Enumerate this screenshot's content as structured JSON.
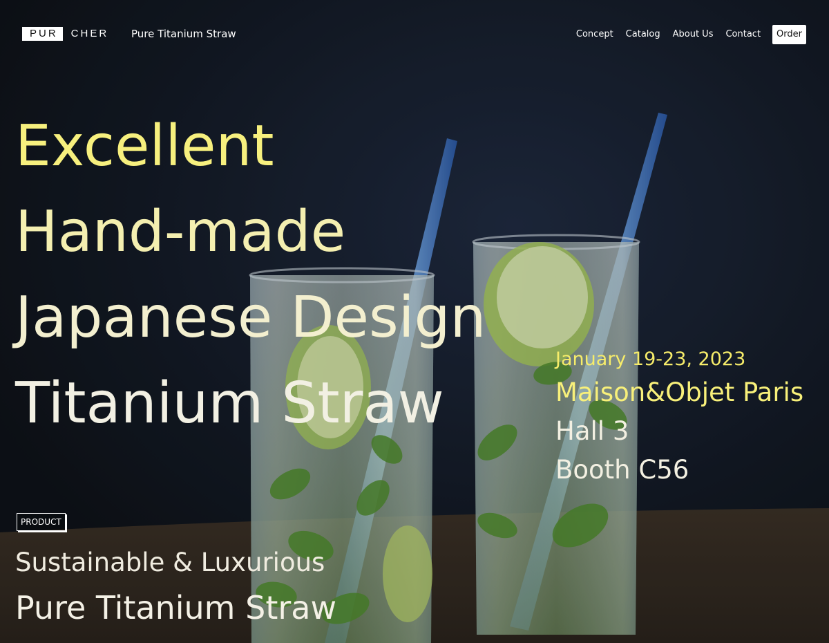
{
  "header": {
    "logo": {
      "boxed": "PUR",
      "rest": "CHER"
    },
    "tagline": "Pure Titanium Straw",
    "nav": [
      "Concept",
      "Catalog",
      "About Us",
      "Contact"
    ],
    "order_label": "Order"
  },
  "hero": {
    "headline": [
      "Excellent",
      "Hand-made",
      "Japanese Design",
      "Titanium Straw"
    ],
    "image": "two glasses of mojito with lime, mint and blue titanium straws"
  },
  "event": {
    "date": "January 19-23, 2023",
    "venue": "Maison&Objet Paris",
    "hall": "Hall 3",
    "booth": "Booth C56"
  },
  "product": {
    "badge": "PRODUCT",
    "subtitle": "Sustainable & Luxurious",
    "title": "Pure Titanium Straw"
  },
  "colors": {
    "headline_yellow": "#f7f07e",
    "event_yellow": "#f6ec6a",
    "cream": "#f3f0e2",
    "background": "#141a24"
  }
}
